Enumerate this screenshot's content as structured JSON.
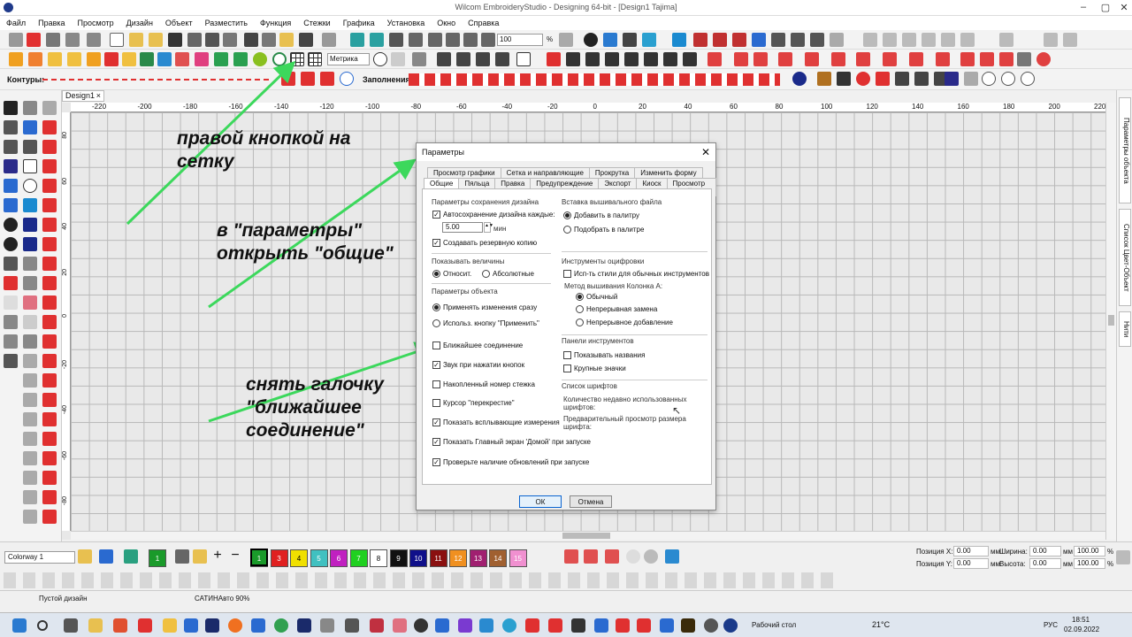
{
  "titlebar": {
    "title": "Wilcom EmbroideryStudio - Designing 64-bit - [Design1     Tajima]"
  },
  "menu": [
    "Файл",
    "Правка",
    "Просмотр",
    "Дизайн",
    "Объект",
    "Разместить",
    "Функция",
    "Стежки",
    "Графика",
    "Установка",
    "Окно",
    "Справка"
  ],
  "toolbar": {
    "zoom": "100",
    "zoom_unit": "%",
    "units": "Метрика",
    "contours_label": "Контуры:",
    "fills_label": "Заполнения:"
  },
  "doc_tab": {
    "label": "Design1",
    "close": "×"
  },
  "hruler": [
    "-220",
    "-200",
    "-180",
    "-160",
    "-140",
    "-120",
    "-100",
    "-80",
    "-60",
    "-40",
    "-20",
    "0",
    "20",
    "40",
    "60",
    "80",
    "100",
    "120",
    "140",
    "160",
    "180",
    "200",
    "220"
  ],
  "vruler": [
    "80",
    "60",
    "40",
    "20",
    "0",
    "-20",
    "-40",
    "-60",
    "-80",
    "-100"
  ],
  "right_tabs": [
    "Параметры объекта",
    "Список Цвет-Объект",
    "Нити"
  ],
  "notes": [
    "правой кнопкой на сетку",
    "в \"параметры\" открыть \"общие\"",
    "снять галочку \"ближайшее соединение\""
  ],
  "dialog": {
    "title": "Параметры",
    "tabs_row1": [
      "Просмотр графики",
      "Сетка и направляющие",
      "Прокрутка",
      "Изменить форму"
    ],
    "tabs_row2": [
      "Общие",
      "Пяльца",
      "Правка",
      "Предупреждение",
      "Экспорт",
      "Киоск",
      "Просмотр дизайна"
    ],
    "save_group": "Параметры сохранения дизайна",
    "autosave": "Автосохранение дизайна каждые:",
    "autosave_value": "5.00",
    "autosave_unit": "мин",
    "backup": "Создавать резервную копию",
    "values_group": "Показывать величины",
    "relative": "Относит.",
    "absolute": "Абсолютные",
    "object_group": "Параметры объекта",
    "apply_now": "Применять изменения сразу",
    "apply_button": "Использ. кнопку \"Применить\"",
    "nearest": "Ближайшее соединение",
    "sound": "Звук при нажатии кнопок",
    "stitch_no": "Накопленный номер стежка",
    "cross_cursor": "Курсор \"перекрестие\"",
    "popup": "Показать всплывающие измерения",
    "home": "Показать Главный экран 'Домой' при запуске",
    "updates": "Проверьте наличие обновлений при запуске",
    "insert_group": "Вставка вышивального файла",
    "add_palette": "Добавить в палитру",
    "match_palette": "Подобрать в палитре",
    "digit_group": "Инструменты оцифровки",
    "use_styles": "Исп-ть стили для обычных инструментов",
    "column_method": "Метод вышивания Колонка А:",
    "normal": "Обычный",
    "continuous": "Непрерывная замена",
    "cont_add": "Непрерывное добавление",
    "toolbar_group": "Панели инструментов",
    "show_names": "Показывать названия",
    "large_icons": "Крупные значки",
    "fonts_group": "Список шрифтов",
    "recent_fonts": "Количество недавно использованных шрифтов:",
    "preview_size": "Предварительный просмотр размера шрифта:",
    "ok": "ОК",
    "cancel": "Отмена"
  },
  "colorway": "Colorway 1",
  "swatches": [
    {
      "n": "1",
      "c": "#1a9a2a"
    },
    {
      "n": "2",
      "c": "#1c3fd8"
    },
    {
      "n": "3",
      "c": "#e02020"
    },
    {
      "n": "4",
      "c": "#f0e000"
    },
    {
      "n": "5",
      "c": "#40c0c0"
    },
    {
      "n": "6",
      "c": "#c020c0"
    },
    {
      "n": "7",
      "c": "#20d020"
    },
    {
      "n": "8",
      "c": "#ffffff"
    },
    {
      "n": "9",
      "c": "#111111"
    },
    {
      "n": "10",
      "c": "#10108a"
    },
    {
      "n": "11",
      "c": "#8a1010"
    },
    {
      "n": "12",
      "c": "#f09020"
    },
    {
      "n": "13",
      "c": "#a02070"
    },
    {
      "n": "14",
      "c": "#a06030"
    },
    {
      "n": "15",
      "c": "#f090d0"
    }
  ],
  "position": {
    "x_label": "Позиция X:",
    "y_label": "Позиция Y:",
    "x": "0.00",
    "y": "0.00",
    "unit": "мм",
    "w_label": "Ширина:",
    "h_label": "Высота:",
    "w": "0.00",
    "h": "0.00",
    "pw": "100.00",
    "ph": "100.00",
    "pct": "%"
  },
  "status": {
    "left": "Пустой дизайн",
    "mid": "САТИНАвто 90%"
  },
  "taskbar": {
    "desktop": "Рабочий стол",
    "temp": "21°C",
    "lang": "РУС",
    "time": "18:51",
    "date": "02.09.2022"
  }
}
